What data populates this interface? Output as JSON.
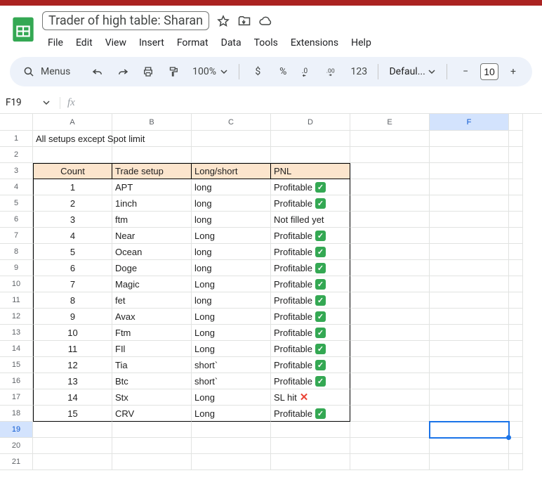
{
  "doc": {
    "title": "Trader of high table: Sharan"
  },
  "menus": {
    "file": "File",
    "edit": "Edit",
    "view": "View",
    "insert": "Insert",
    "format": "Format",
    "data": "Data",
    "tools": "Tools",
    "extensions": "Extensions",
    "help": "Help"
  },
  "toolbar": {
    "search": "Menus",
    "zoom": "100%",
    "currency": "$",
    "percent": "%",
    "decDec": ".0",
    "incDec": ".00",
    "num": "123",
    "font": "Defaul...",
    "fontsize": "10",
    "minus": "−",
    "plus": "+"
  },
  "namebox": "F19",
  "columns": [
    "A",
    "B",
    "C",
    "D",
    "E",
    "F"
  ],
  "row1_text": "All setups except Spot limit",
  "headers": {
    "count": "Count",
    "setup": "Trade setup",
    "ls": "Long/short",
    "pnl": "PNL"
  },
  "rows": [
    {
      "n": "1",
      "setup": "APT",
      "ls": "long",
      "pnl": "Profitable",
      "icon": "check"
    },
    {
      "n": "2",
      "setup": "1inch",
      "ls": "long",
      "pnl": "Profitable",
      "icon": "check"
    },
    {
      "n": "3",
      "setup": "ftm",
      "ls": "long",
      "pnl": "Not filled yet",
      "icon": ""
    },
    {
      "n": "4",
      "setup": "Near",
      "ls": "Long",
      "pnl": "Profitable",
      "icon": "check"
    },
    {
      "n": "5",
      "setup": "Ocean",
      "ls": "long",
      "pnl": "Profitable",
      "icon": "check"
    },
    {
      "n": "6",
      "setup": "Doge",
      "ls": "long",
      "pnl": "Profitable",
      "icon": "check"
    },
    {
      "n": "7",
      "setup": "Magic",
      "ls": "Long",
      "pnl": "Profitable",
      "icon": "check"
    },
    {
      "n": "8",
      "setup": "fet",
      "ls": "long",
      "pnl": "Profitable",
      "icon": "check"
    },
    {
      "n": "9",
      "setup": "Avax",
      "ls": "Long",
      "pnl": "Profitable",
      "icon": "check"
    },
    {
      "n": "10",
      "setup": "Ftm",
      "ls": "Long",
      "pnl": "Profitable",
      "icon": "check"
    },
    {
      "n": "11",
      "setup": "FIl",
      "ls": "Long",
      "pnl": "Profitable",
      "icon": "check"
    },
    {
      "n": "12",
      "setup": "Tia",
      "ls": "short`",
      "pnl": "Profitable",
      "icon": "check"
    },
    {
      "n": "13",
      "setup": "Btc",
      "ls": "short`",
      "pnl": "Profitable",
      "icon": "check"
    },
    {
      "n": "14",
      "setup": "Stx",
      "ls": "Long",
      "pnl": "SL hit",
      "icon": "x"
    },
    {
      "n": "15",
      "setup": "CRV",
      "ls": "Long",
      "pnl": "Profitable",
      "icon": "check"
    }
  ],
  "selected": {
    "col": "F",
    "row": 19
  }
}
